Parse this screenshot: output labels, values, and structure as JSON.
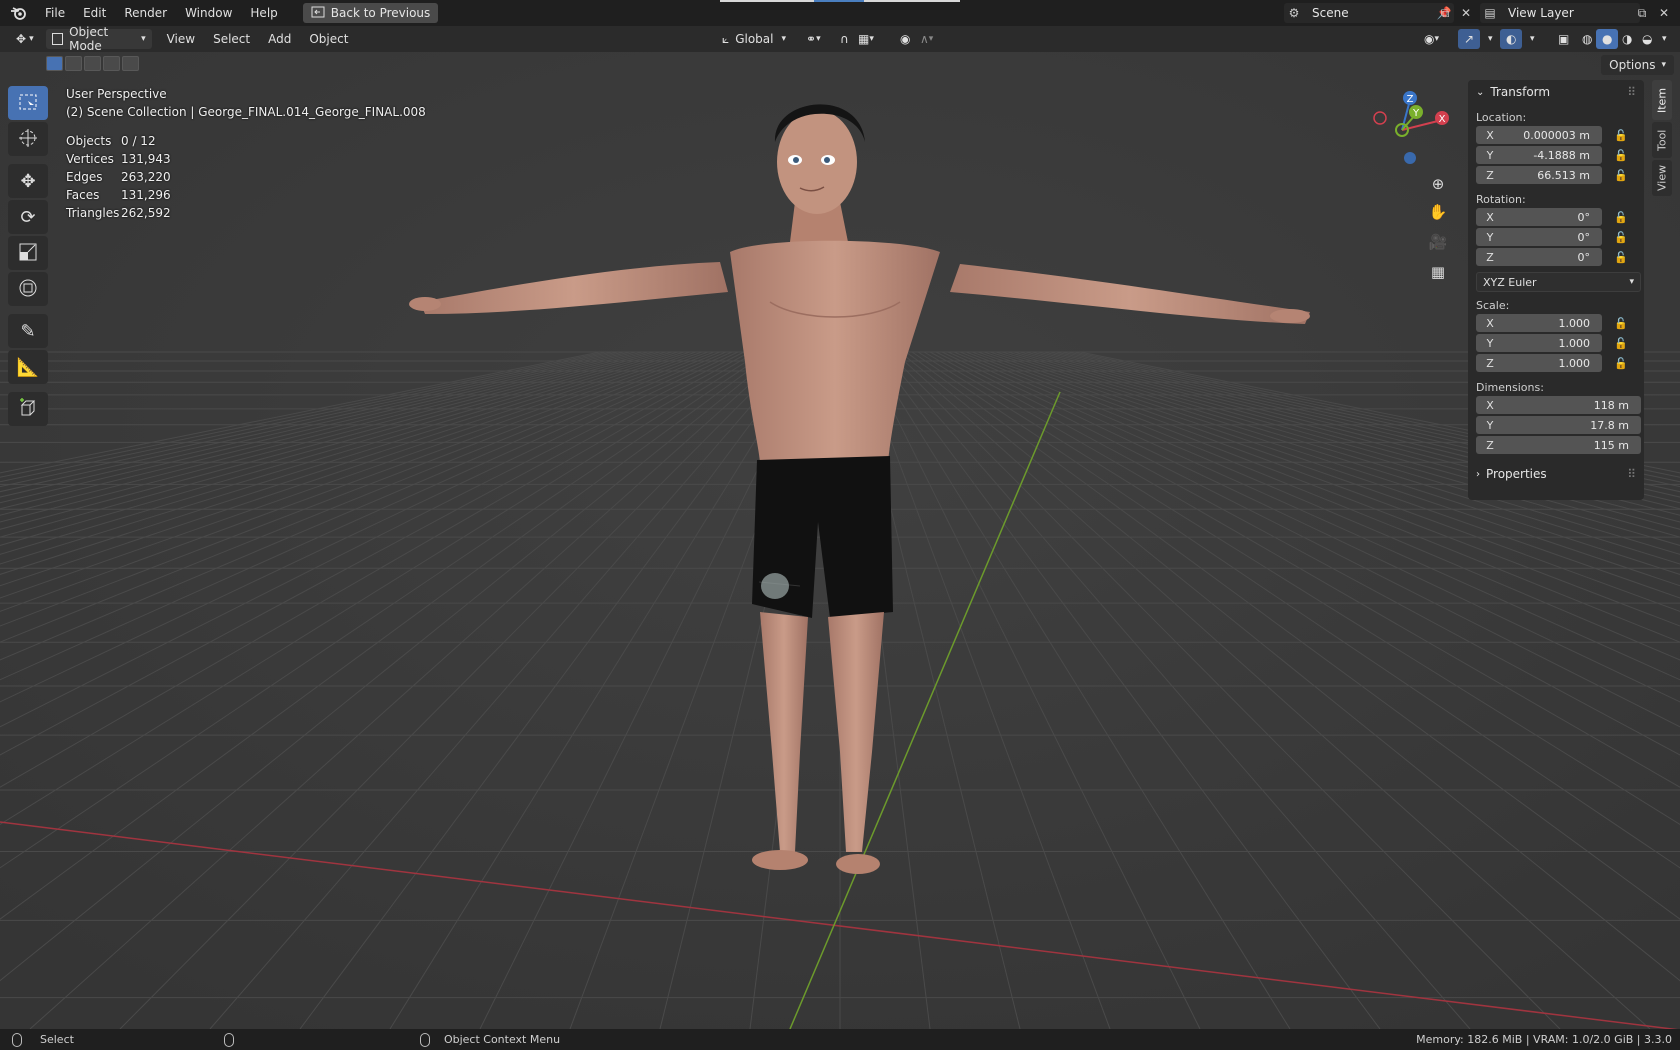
{
  "menubar": {
    "items": [
      "File",
      "Edit",
      "Render",
      "Window",
      "Help"
    ],
    "back_button": "Back to Previous",
    "scene": "Scene",
    "view_layer": "View Layer"
  },
  "header": {
    "mode": "Object Mode",
    "menus": [
      "View",
      "Select",
      "Add",
      "Object"
    ],
    "transform_orientation": "Global",
    "options": "Options"
  },
  "overlay": {
    "perspective": "User Perspective",
    "collection": "(2) Scene Collection | George_FINAL.014_George_FINAL.008",
    "stats": [
      {
        "key": "Objects",
        "value": "0 / 12"
      },
      {
        "key": "Vertices",
        "value": "131,943"
      },
      {
        "key": "Edges",
        "value": "263,220"
      },
      {
        "key": "Faces",
        "value": "131,296"
      },
      {
        "key": "Triangles",
        "value": "262,592"
      }
    ]
  },
  "gizmo": {
    "x": "X",
    "y": "Y",
    "z": "Z"
  },
  "npanel": {
    "title": "Transform",
    "location_label": "Location:",
    "location": [
      {
        "axis": "X",
        "value": "0.000003 m"
      },
      {
        "axis": "Y",
        "value": "-4.1888 m"
      },
      {
        "axis": "Z",
        "value": "66.513 m"
      }
    ],
    "rotation_label": "Rotation:",
    "rotation": [
      {
        "axis": "X",
        "value": "0°"
      },
      {
        "axis": "Y",
        "value": "0°"
      },
      {
        "axis": "Z",
        "value": "0°"
      }
    ],
    "rotation_mode": "XYZ Euler",
    "scale_label": "Scale:",
    "scale": [
      {
        "axis": "X",
        "value": "1.000"
      },
      {
        "axis": "Y",
        "value": "1.000"
      },
      {
        "axis": "Z",
        "value": "1.000"
      }
    ],
    "dimensions_label": "Dimensions:",
    "dimensions": [
      {
        "axis": "X",
        "value": "118 m"
      },
      {
        "axis": "Y",
        "value": "17.8 m"
      },
      {
        "axis": "Z",
        "value": "115 m"
      }
    ],
    "properties": "Properties"
  },
  "sidetabs": [
    "Item",
    "Tool",
    "View"
  ],
  "statusbar": {
    "left": "Select",
    "middle": "Object Context Menu",
    "right": "Memory: 182.6 MiB | VRAM: 1.0/2.0 GiB | 3.3.0"
  },
  "colors": {
    "accent": "#4772b3",
    "x_axis": "#d3404f",
    "y_axis": "#7ab02c",
    "z_axis": "#3a76c9"
  }
}
